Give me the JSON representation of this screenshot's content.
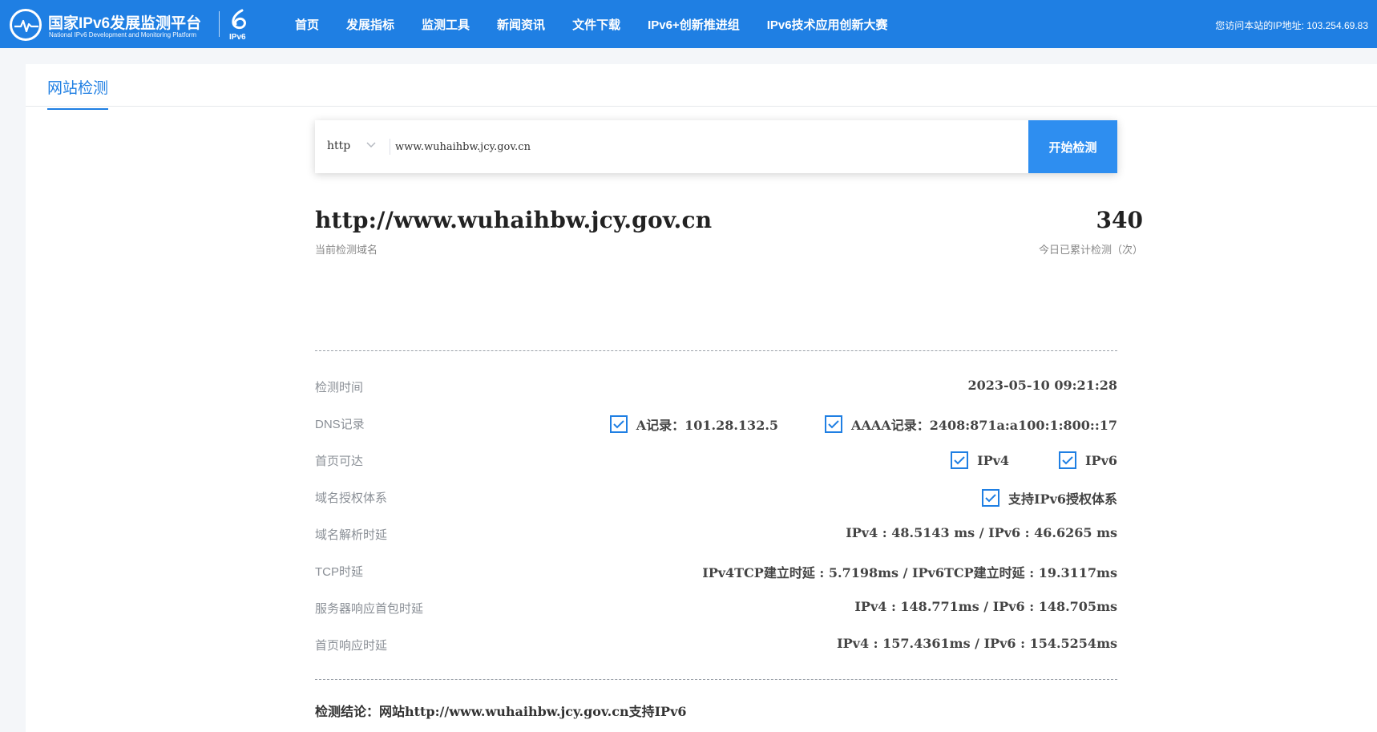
{
  "header": {
    "logo_title": "国家IPv6发展监测平台",
    "logo_subtitle": "National IPv6 Development and Monitoring Platform",
    "badge_label": "IPv6",
    "nav": [
      "首页",
      "发展指标",
      "监测工具",
      "新闻资讯",
      "文件下载",
      "IPv6+创新推进组",
      "IPv6技术应用创新大赛"
    ],
    "ip_info": "您访问本站的IP地址: 103.254.69.83",
    "brand_color": "#1f7fe3"
  },
  "tab": {
    "label": "网站检测"
  },
  "search": {
    "protocol": "http",
    "url_value": "www.wuhaihbw.jcy.gov.cn",
    "button_label": "开始检测"
  },
  "result": {
    "domain": "http://www.wuhaihbw.jcy.gov.cn",
    "domain_caption": "当前检测域名",
    "count": "340",
    "count_caption": "今日已累计检测（次）",
    "rows": {
      "time": {
        "label": "检测时间",
        "value": "2023-05-10 09:21:28"
      },
      "dns": {
        "label": "DNS记录",
        "a": "A记录：101.28.132.5",
        "aaaa": "AAAA记录：2408:871a:a100:1:800::17"
      },
      "homepage": {
        "label": "首页可达",
        "ipv4": "IPv4",
        "ipv6": "IPv6"
      },
      "auth": {
        "label": "域名授权体系",
        "value": "支持IPv6授权体系"
      },
      "resolve": {
        "label": "域名解析时延",
        "value": "IPv4 : 48.5143 ms / IPv6 : 46.6265 ms"
      },
      "tcp": {
        "label": "TCP时延",
        "value": "IPv4TCP建立时延 : 5.7198ms / IPv6TCP建立时延 : 19.3117ms"
      },
      "server": {
        "label": "服务器响应首包时延",
        "value": "IPv4 : 148.771ms / IPv6 : 148.705ms"
      },
      "home_resp": {
        "label": "首页响应时延",
        "value": "IPv4 : 157.4361ms / IPv6 : 154.5254ms"
      }
    },
    "conclusion": "检测结论：网站http://www.wuhaihbw.jcy.gov.cn支持IPv6"
  }
}
